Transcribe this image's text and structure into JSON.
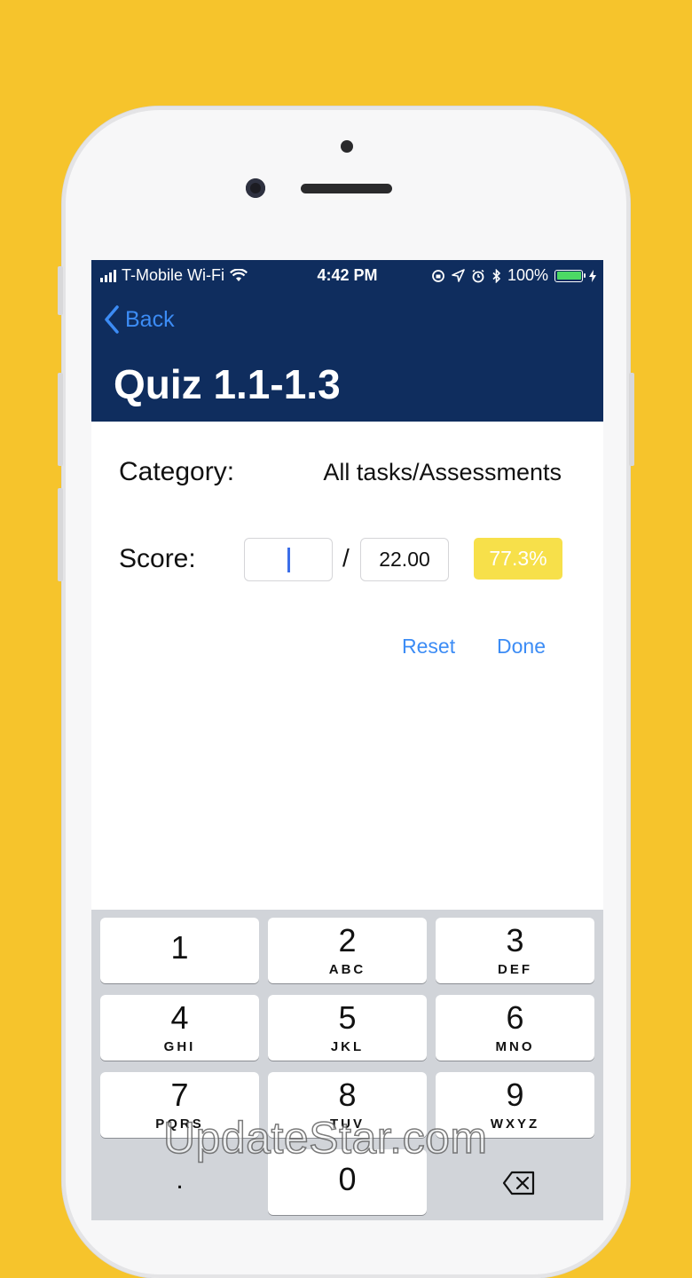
{
  "status_bar": {
    "carrier": "T-Mobile Wi-Fi",
    "time": "4:42 PM",
    "battery": "100%"
  },
  "nav": {
    "back_label": "Back",
    "title": "Quiz 1.1-1.3"
  },
  "form": {
    "category_label": "Category:",
    "category_value": "All tasks/Assessments",
    "score_label": "Score:",
    "score_value": "",
    "separator": "/",
    "total_value": "22.00",
    "percentage": "77.3%",
    "reset_label": "Reset",
    "done_label": "Done"
  },
  "keypad": {
    "keys": [
      {
        "digit": "1",
        "letters": ""
      },
      {
        "digit": "2",
        "letters": "ABC"
      },
      {
        "digit": "3",
        "letters": "DEF"
      },
      {
        "digit": "4",
        "letters": "GHI"
      },
      {
        "digit": "5",
        "letters": "JKL"
      },
      {
        "digit": "6",
        "letters": "MNO"
      },
      {
        "digit": "7",
        "letters": "PQRS"
      },
      {
        "digit": "8",
        "letters": "TUV"
      },
      {
        "digit": "9",
        "letters": "WXYZ"
      }
    ],
    "decimal": ".",
    "zero": "0",
    "delete_icon": "backspace-icon"
  },
  "watermark": "UpdateStar.com",
  "colors": {
    "background": "#f6c42c",
    "navbar": "#0f2d5e",
    "accent": "#3c8cf5",
    "badge": "#f7e04a"
  }
}
